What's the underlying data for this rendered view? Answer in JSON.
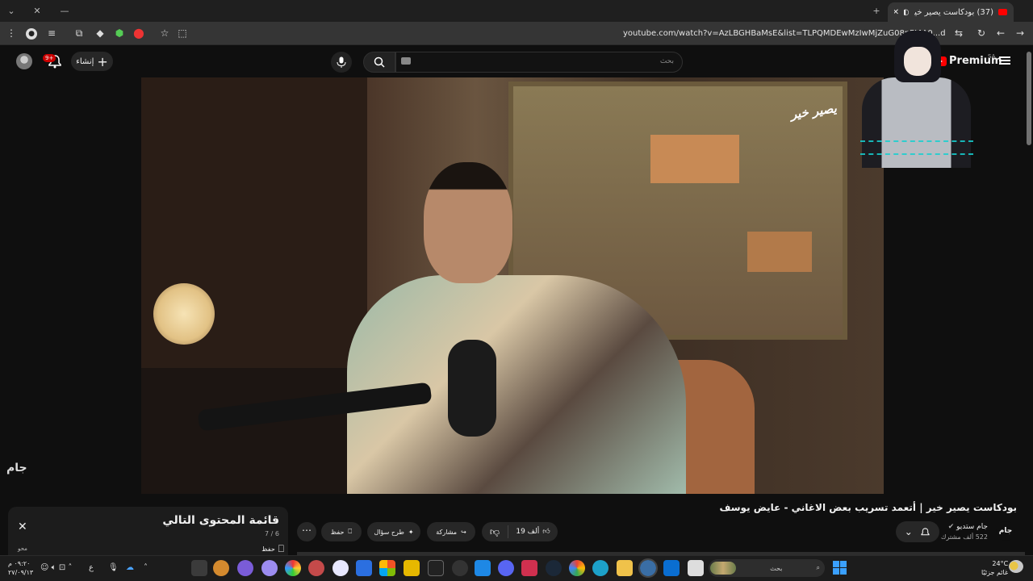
{
  "browser": {
    "tab_title": "(37) بودكاست يصير خير | أتع...",
    "url": "youtube.com/watch?v=AzLBGHBaMsE&list=TLPQMDEwMzIwMjZuG08nPI4A0...dex=6",
    "window_controls": [
      "—",
      "▢",
      "✕"
    ]
  },
  "youtube_header": {
    "create_label": "إنشاء",
    "notif_badge": "9+",
    "search_placeholder": "بحث",
    "logo_text": "Premium",
    "country": "SA"
  },
  "video": {
    "watermark_top": "يصير خير",
    "watermark_corner": "جام",
    "title": "بودكاست يصير خير | أتعمد تسريب بعض الاغاني - عايض يوسف",
    "channel_name": "جام ستديو",
    "subscribers": "522 ألف مشترك",
    "channel_logo_text": "جام",
    "likes": "19 ألف",
    "share_label": "مشاركة",
    "ask_label": "طرح سؤال",
    "save_label": "حفظ"
  },
  "playlist_panel": {
    "title": "قائمة المحتوى التالي",
    "position": "7 / 6",
    "save_label": "حفظ",
    "autoplay_label": "محو"
  },
  "taskbar": {
    "search_label": "بحث",
    "temperature": "24°C",
    "weather": "غائم جزئيًا",
    "time": "٠٩:٢٠ م",
    "date": "٢٧/٠٩/١٣",
    "lang": "ع"
  },
  "colors": {
    "accent_red": "#ff0000",
    "background": "#0f0f0f",
    "pill_bg": "#272727"
  }
}
